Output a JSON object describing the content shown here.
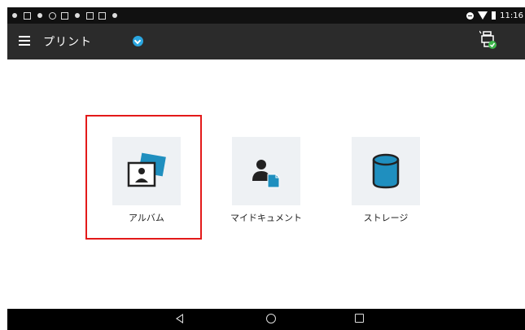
{
  "status_bar": {
    "time": "11:16"
  },
  "app_bar": {
    "title": "プリント",
    "menu_icon": "hamburger-menu-icon",
    "dropdown_icon": "chevron-down-icon",
    "printer_icon": "printer-status-icon"
  },
  "tiles": [
    {
      "label": "アルバム",
      "icon": "album-photo-icon"
    },
    {
      "label": "マイドキュメント",
      "icon": "my-document-icon"
    },
    {
      "label": "ストレージ",
      "icon": "storage-icon"
    }
  ],
  "colors": {
    "app_bar": "#2b2b2b",
    "accent": "#2aa6e0",
    "icon_blue": "#1f8fbf",
    "highlight": "#e31a1a",
    "tile_bg": "#eef1f4"
  }
}
